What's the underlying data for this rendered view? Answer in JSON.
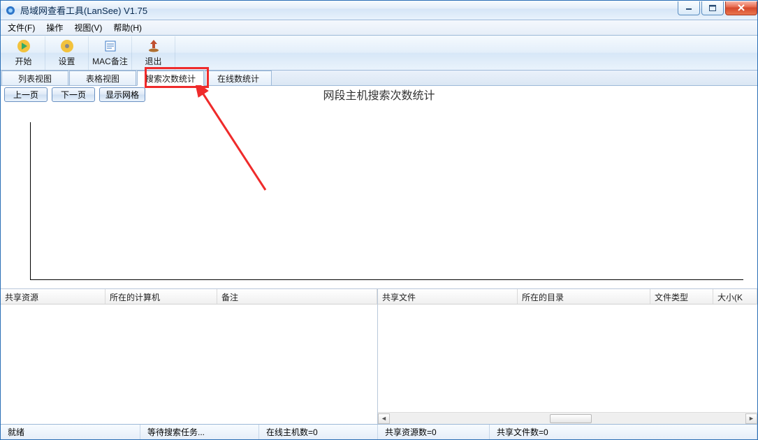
{
  "title": "局域网查看工具(LanSee) V1.75",
  "menu": {
    "file": "文件(F)",
    "ops": "操作",
    "view": "视图(V)",
    "help": "帮助(H)"
  },
  "toolbar": {
    "start": "开始",
    "settings": "设置",
    "mac": "MAC备注",
    "exit": "退出"
  },
  "tabs": {
    "t1": "列表视图",
    "t2": "表格视图",
    "t3": "搜索次数统计",
    "t4": "在线数统计"
  },
  "page_buttons": {
    "prev": "上一页",
    "next": "下一页",
    "grid": "显示网格"
  },
  "chart_title": "网段主机搜索次数统计",
  "left_cols": {
    "c1": "共享资源",
    "c2": "所在的计算机",
    "c3": "备注"
  },
  "right_cols": {
    "c1": "共享文件",
    "c2": "所在的目录",
    "c3": "文件类型",
    "c4": "大小(K"
  },
  "status": {
    "s1": "就绪",
    "s2": "等待搜索任务...",
    "s3": "在线主机数=0",
    "s4": "共享资源数=0",
    "s5": "共享文件数=0"
  }
}
